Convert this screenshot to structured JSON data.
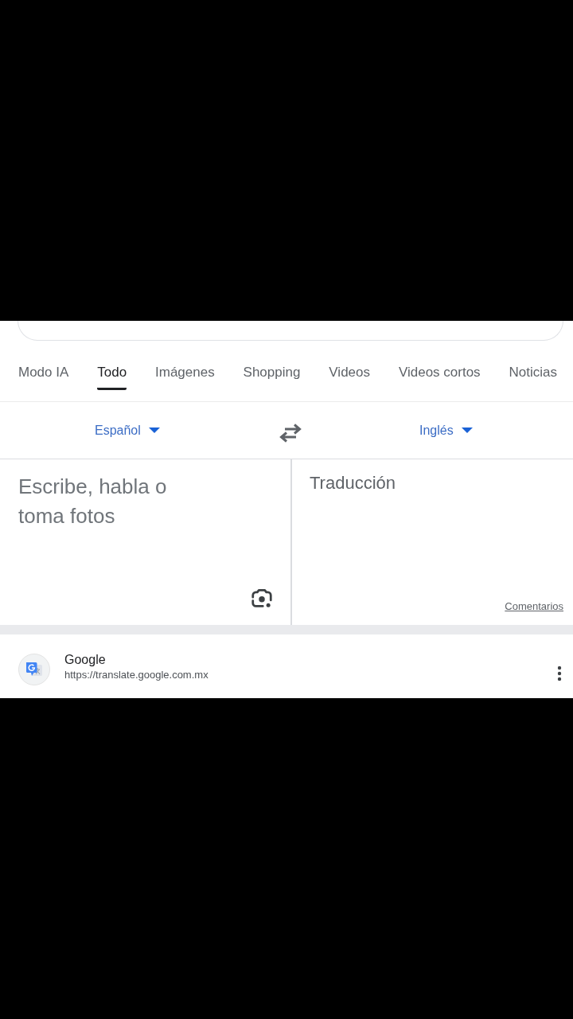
{
  "tabs": [
    {
      "label": "Modo IA",
      "selected": false
    },
    {
      "label": "Todo",
      "selected": true
    },
    {
      "label": "Imágenes",
      "selected": false
    },
    {
      "label": "Shopping",
      "selected": false
    },
    {
      "label": "Videos",
      "selected": false
    },
    {
      "label": "Videos cortos",
      "selected": false
    },
    {
      "label": "Noticias",
      "selected": false
    }
  ],
  "translator": {
    "source_language": "Español",
    "target_language": "Inglés",
    "input": {
      "placeholder": "Escribe, habla o toma fotos"
    },
    "output_label": "Traducción",
    "feedback_link": "Comentarios"
  },
  "result": {
    "site_name": "Google",
    "url": "https://translate.google.com.mx"
  }
}
